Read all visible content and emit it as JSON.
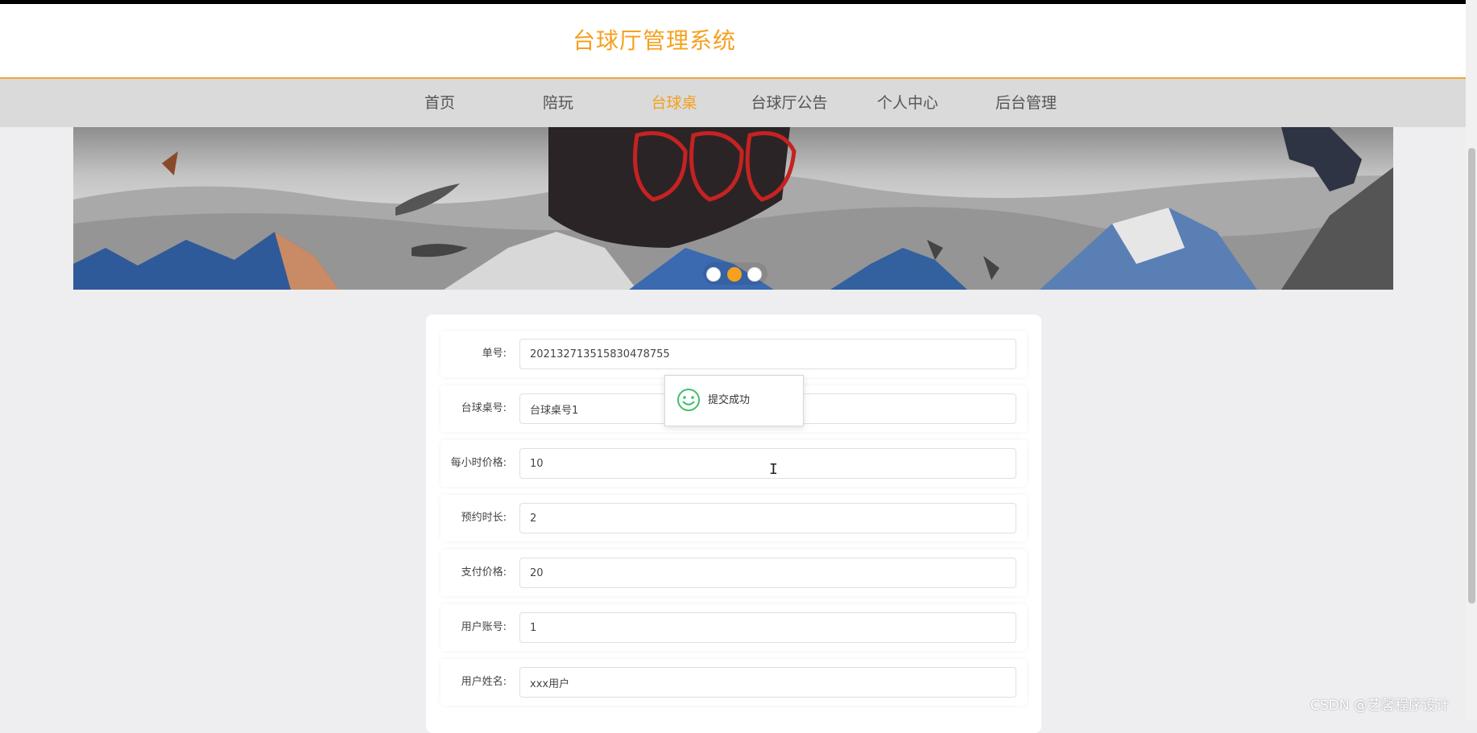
{
  "site": {
    "title": "台球厅管理系统"
  },
  "nav": {
    "items": [
      {
        "label": "首页"
      },
      {
        "label": "陪玩"
      },
      {
        "label": "台球桌"
      },
      {
        "label": "台球厅公告"
      },
      {
        "label": "个人中心"
      },
      {
        "label": "后台管理"
      }
    ],
    "active_index": 2
  },
  "carousel": {
    "slide_count": 3,
    "active_index": 1
  },
  "form": {
    "fields": [
      {
        "label": "单号:",
        "value": "202132713515830478755"
      },
      {
        "label": "台球桌号:",
        "value": "台球桌号1"
      },
      {
        "label": "每小时价格:",
        "value": "10"
      },
      {
        "label": "预约时长:",
        "value": "2"
      },
      {
        "label": "支付价格:",
        "value": "20"
      },
      {
        "label": "用户账号:",
        "value": "1"
      },
      {
        "label": "用户姓名:",
        "value": "xxx用户"
      }
    ]
  },
  "toast": {
    "message": "提交成功",
    "icon": "smile-icon"
  },
  "watermark": "CSDN @艺馨程序设计",
  "colors": {
    "accent": "#f5a01e",
    "success": "#3ec06a"
  }
}
